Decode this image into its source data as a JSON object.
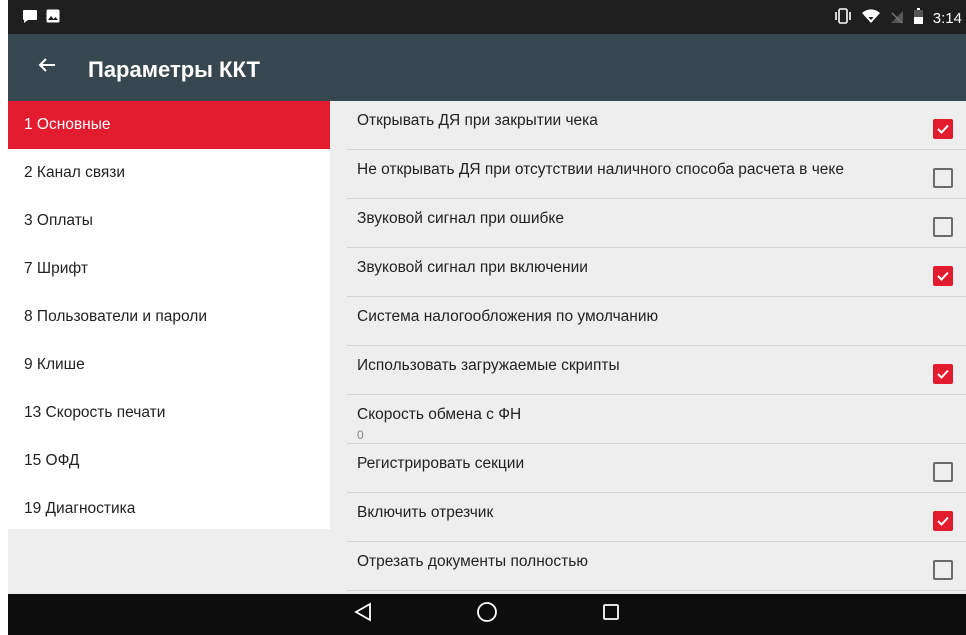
{
  "status_bar": {
    "time": "3:14"
  },
  "app_bar": {
    "title": "Параметры ККТ"
  },
  "sidebar": {
    "items": [
      {
        "label": "1 Основные",
        "active": true
      },
      {
        "label": "2 Канал связи",
        "active": false
      },
      {
        "label": "3 Оплаты",
        "active": false
      },
      {
        "label": "7 Шрифт",
        "active": false
      },
      {
        "label": "8 Пользователи и пароли",
        "active": false
      },
      {
        "label": "9 Клише",
        "active": false
      },
      {
        "label": "13 Скорость печати",
        "active": false
      },
      {
        "label": "15 ОФД",
        "active": false
      },
      {
        "label": "19 Диагностика",
        "active": false
      }
    ]
  },
  "settings": [
    {
      "label": "Открывать ДЯ при закрытии чека",
      "checkbox": true,
      "checked": true
    },
    {
      "label": "Не открывать ДЯ при отсутствии наличного способа расчета в чеке",
      "checkbox": true,
      "checked": false
    },
    {
      "label": "Звуковой сигнал при ошибке",
      "checkbox": true,
      "checked": false
    },
    {
      "label": "Звуковой сигнал при включении",
      "checkbox": true,
      "checked": true
    },
    {
      "label": "Система налогообложения по умолчанию",
      "checkbox": false
    },
    {
      "label": "Использовать загружаемые скрипты",
      "checkbox": true,
      "checked": true
    },
    {
      "label": "Скорость обмена с ФН",
      "checkbox": false,
      "value": "0"
    },
    {
      "label": "Регистрировать секции",
      "checkbox": true,
      "checked": false
    },
    {
      "label": "Включить отрезчик",
      "checkbox": true,
      "checked": true
    },
    {
      "label": "Отрезать документы полностью",
      "checkbox": true,
      "checked": false
    }
  ],
  "colors": {
    "accent": "#e31b2e",
    "app_bar": "#37474f",
    "status_bar": "#1f1f1f",
    "nav_bar": "#0d0d0d"
  },
  "icons": {
    "back": "arrow-left-icon",
    "nav": [
      "back-triangle-icon",
      "home-circle-icon",
      "recents-square-icon"
    ]
  }
}
